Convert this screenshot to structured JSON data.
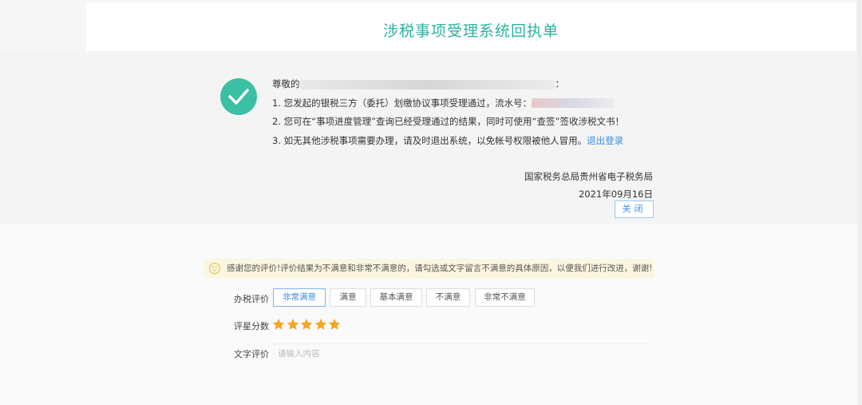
{
  "header": {
    "title": "涉税事项受理系统回执单"
  },
  "message": {
    "greeting_prefix": "尊敬的",
    "greeting_suffix": "：",
    "line1_prefix": "1. 您发起的银税三方（委托）划缴协议事项受理通过，流水号：",
    "line2": "2. 您可在“事项进度管理”查询已经受理通过的结果，同时可使用“查签”签收涉税文书！",
    "line3_prefix": "3. 如无其他涉税事项需要办理，请及时退出系统，以免帐号权限被他人冒用。",
    "logout_link": "退出登录"
  },
  "signature": {
    "org": "国家税务总局贵州省电子税务局",
    "date": "2021年09月16日"
  },
  "close_button": "关闭",
  "evaluation": {
    "notice": "感谢您的评价!评价结果为不满意和非常不满意的，请勾选或文字留言不满意的具体原因，以便我们进行改进，谢谢!",
    "rating_label": "办税评价",
    "options": [
      "非常满意",
      "满意",
      "基本满意",
      "不满意",
      "非常不满意"
    ],
    "selected_option": "非常满意",
    "score_label": "评星分数",
    "stars": 5,
    "max_stars": 5,
    "star_color": "#f5a623",
    "text_label": "文字评价",
    "text_placeholder": "请输入内容"
  },
  "colors": {
    "accent": "#2bb3a0",
    "link": "#3a8ee6"
  }
}
